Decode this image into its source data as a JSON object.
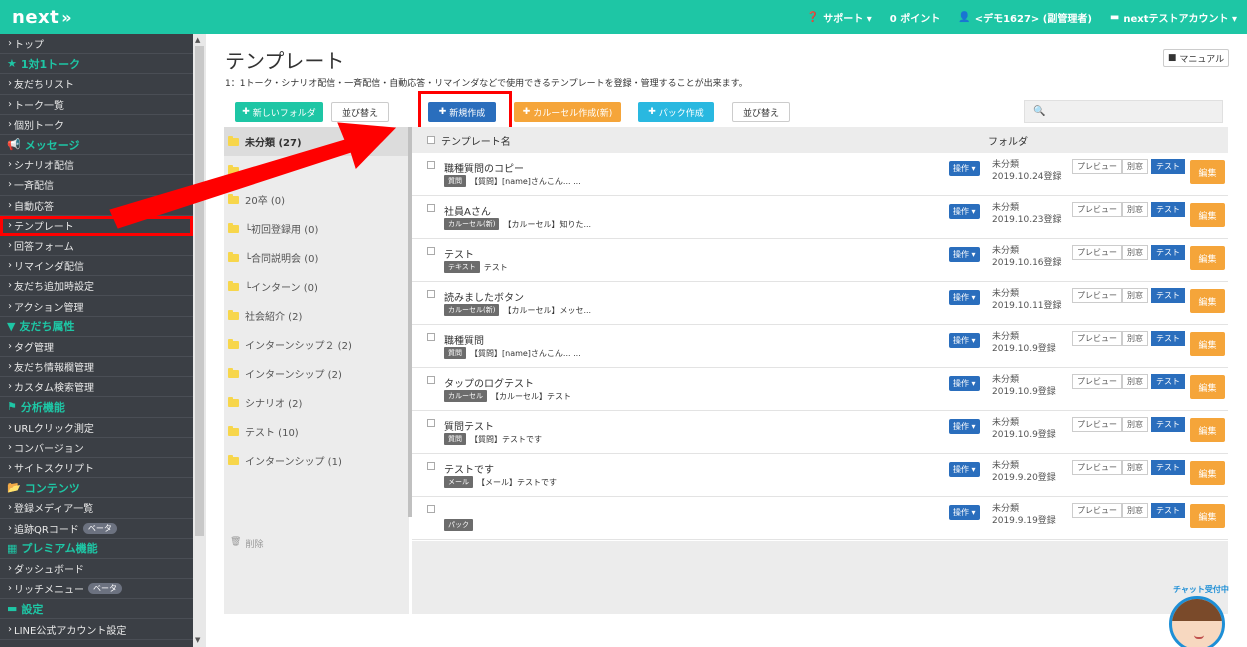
{
  "topbar": {
    "logo": "next",
    "logo_chevron": "»",
    "support": "サポート ▾",
    "points": "0 ポイント",
    "user": "<デモ1627> (副管理者)",
    "account": "nextテストアカウント ▾"
  },
  "sidebar": {
    "items": [
      {
        "type": "item",
        "label": "トップ"
      },
      {
        "type": "section",
        "label": "1対1トーク",
        "icon": "star-icon"
      },
      {
        "type": "item",
        "label": "友だちリスト"
      },
      {
        "type": "item",
        "label": "トーク一覧"
      },
      {
        "type": "item",
        "label": "個別トーク"
      },
      {
        "type": "section",
        "label": "メッセージ",
        "icon": "megaphone-icon"
      },
      {
        "type": "item",
        "label": "シナリオ配信"
      },
      {
        "type": "item",
        "label": "一斉配信"
      },
      {
        "type": "item",
        "label": "自動応答"
      },
      {
        "type": "item",
        "label": "テンプレート",
        "active": true
      },
      {
        "type": "item",
        "label": "回答フォーム"
      },
      {
        "type": "item",
        "label": "リマインダ配信"
      },
      {
        "type": "item",
        "label": "友だち追加時設定"
      },
      {
        "type": "item",
        "label": "アクション管理"
      },
      {
        "type": "section",
        "label": "友だち属性",
        "icon": "filter-icon"
      },
      {
        "type": "item",
        "label": "タグ管理"
      },
      {
        "type": "item",
        "label": "友だち情報欄管理"
      },
      {
        "type": "item",
        "label": "カスタム検索管理"
      },
      {
        "type": "section",
        "label": "分析機能",
        "icon": "flag-icon"
      },
      {
        "type": "item",
        "label": "URLクリック測定"
      },
      {
        "type": "item",
        "label": "コンバージョン"
      },
      {
        "type": "item",
        "label": "サイトスクリプト"
      },
      {
        "type": "section",
        "label": "コンテンツ",
        "icon": "folder-icon"
      },
      {
        "type": "item",
        "label": "登録メディア一覧"
      },
      {
        "type": "item",
        "label": "追跡QRコード",
        "badge": "ベータ"
      },
      {
        "type": "section",
        "label": "プレミアム機能",
        "icon": "grid-icon"
      },
      {
        "type": "item",
        "label": "ダッシュボード"
      },
      {
        "type": "item",
        "label": "リッチメニュー",
        "badge": "ベータ"
      },
      {
        "type": "section",
        "label": "設定",
        "icon": "chat-icon"
      },
      {
        "type": "item",
        "label": "LINE公式アカウント設定"
      }
    ]
  },
  "main": {
    "title": "テンプレート",
    "description": "1：1トーク・シナリオ配信・一斉配信・自動応答・リマインダなどで使用できるテンプレートを登録・管理することが出来ます。",
    "manual_label": "マニュアル",
    "buttons": {
      "new_folder": "新しいフォルダ",
      "sort_folder": "並び替え",
      "new_create": "新規作成",
      "carousel_create": "カルーセル作成(新)",
      "pack_create": "パック作成",
      "sort_templates": "並び替え"
    },
    "search_placeholder": "",
    "folders": [
      {
        "label": "未分類 (27)",
        "selected": true
      },
      {
        "label": ""
      },
      {
        "label": "20卒 (0)"
      },
      {
        "label": "└初回登録用 (0)"
      },
      {
        "label": "└合同説明会 (0)"
      },
      {
        "label": "└インターン (0)"
      },
      {
        "label": "社会紹介 (2)"
      },
      {
        "label": "インターンシップ２ (2)"
      },
      {
        "label": "インターンシップ (2)"
      },
      {
        "label": "シナリオ (2)"
      },
      {
        "label": "テスト (10)"
      },
      {
        "label": "インターンシップ (1)"
      }
    ],
    "delete_label": "削除",
    "table": {
      "header_name": "テンプレート名",
      "header_folder": "フォルダ",
      "op_label": "操作 ▾",
      "preview_label": "プレビュー",
      "window_label": "別窓",
      "test_label": "テスト",
      "edit_label": "編集",
      "rows": [
        {
          "name": "職種質問のコピー",
          "tag": "質問",
          "sub": "【質問】[name]さんこん... ...",
          "folder": "未分類",
          "date": "2019.10.24登録"
        },
        {
          "name": "社員Aさん",
          "tag": "カルーセル(新)",
          "sub": "【カルーセル】知りた...",
          "folder": "未分類",
          "date": "2019.10.23登録"
        },
        {
          "name": "テスト",
          "tag": "テキスト",
          "sub": "テスト",
          "folder": "未分類",
          "date": "2019.10.16登録"
        },
        {
          "name": "読みましたボタン",
          "tag": "カルーセル(新)",
          "sub": "【カルーセル】メッセ...",
          "folder": "未分類",
          "date": "2019.10.11登録"
        },
        {
          "name": "職種質問",
          "tag": "質問",
          "sub": "【質問】[name]さんこん... ...",
          "folder": "未分類",
          "date": "2019.10.9登録"
        },
        {
          "name": "タップのログテスト",
          "tag": "カルーセル",
          "sub": "【カルーセル】テスト",
          "folder": "未分類",
          "date": "2019.10.9登録"
        },
        {
          "name": "質問テスト",
          "tag": "質問",
          "sub": "【質問】テストです",
          "folder": "未分類",
          "date": "2019.10.9登録"
        },
        {
          "name": "テストです",
          "tag": "メール",
          "sub": "【メール】テストです",
          "folder": "未分類",
          "date": "2019.9.20登録"
        },
        {
          "name": "",
          "tag": "パック",
          "sub": "",
          "folder": "未分類",
          "date": "2019.9.19登録"
        }
      ]
    }
  },
  "chat": {
    "badge": "チャット受付中"
  },
  "colors": {
    "brand": "#1ec6a5",
    "sidebar_bg": "#3b3f45",
    "primary_blue": "#2a6ebd",
    "orange": "#f5a53a",
    "highlight_red": "#ff0000"
  }
}
